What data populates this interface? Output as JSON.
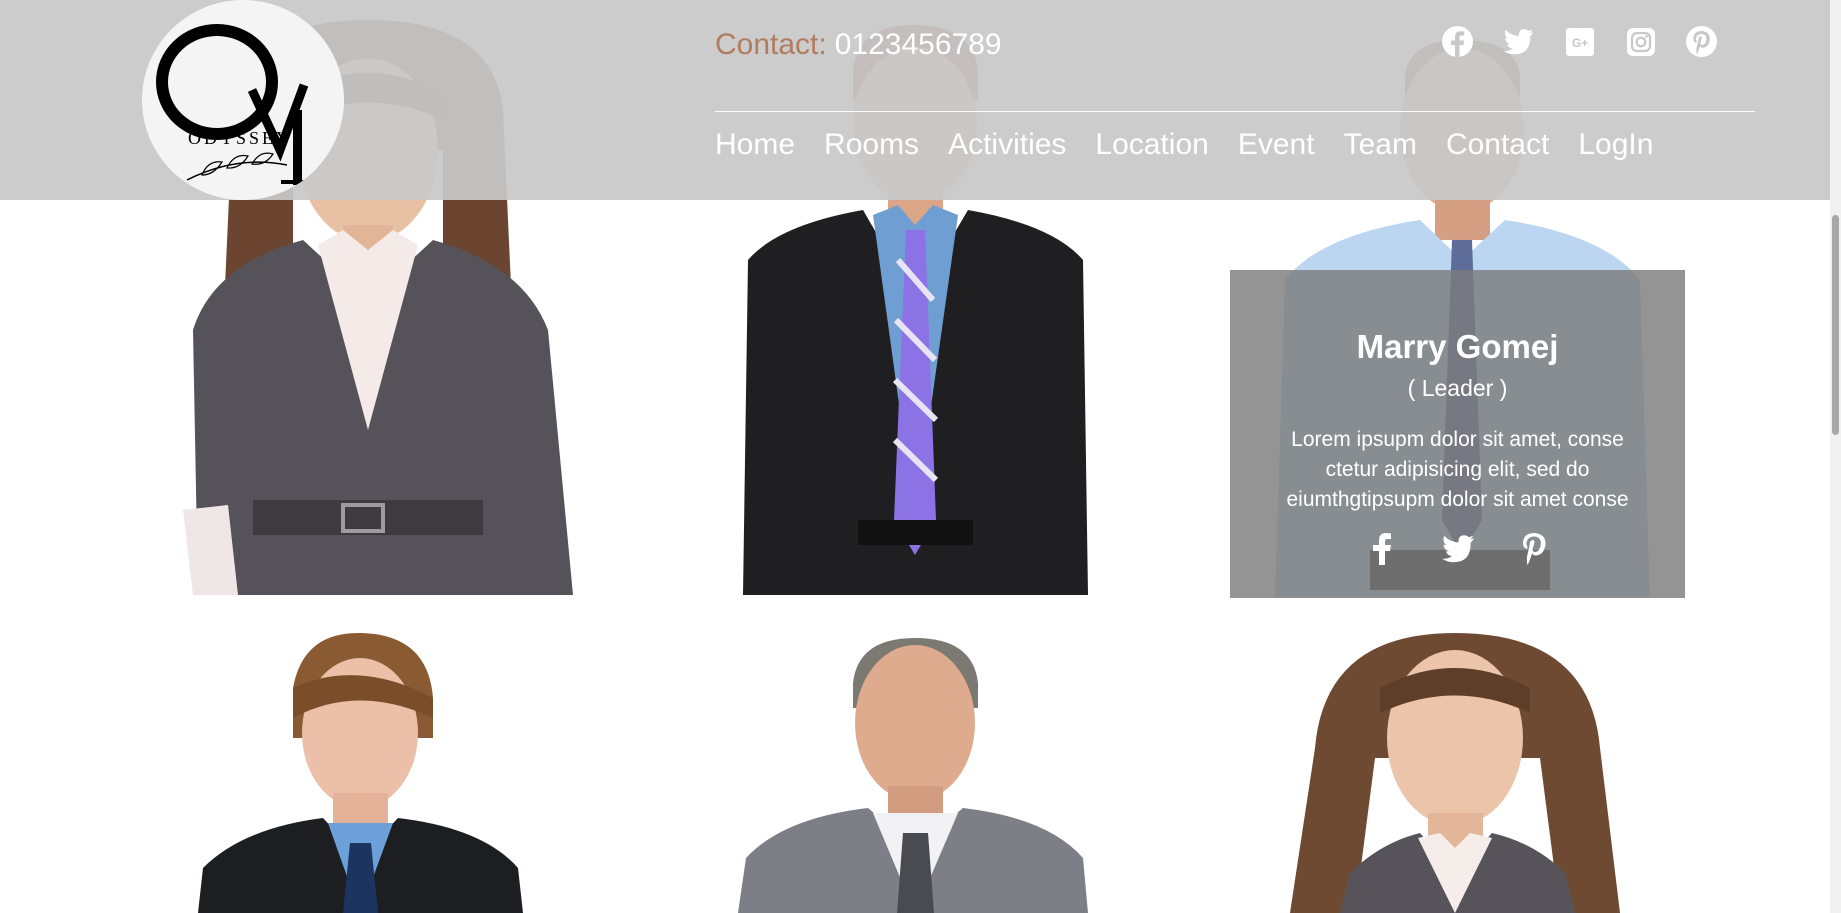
{
  "brand": {
    "logo_text": "ODYSSEY",
    "logo_monogram": "OY"
  },
  "header": {
    "contact_label": "Contact:",
    "contact_phone": "0123456789",
    "social_icons": [
      "facebook-icon",
      "twitter-icon",
      "google-plus-icon",
      "instagram-icon",
      "pinterest-icon"
    ]
  },
  "nav": {
    "items": [
      {
        "label": "Home"
      },
      {
        "label": "Rooms"
      },
      {
        "label": "Activities"
      },
      {
        "label": "Location"
      },
      {
        "label": "Event"
      },
      {
        "label": "Team"
      },
      {
        "label": "Contact"
      },
      {
        "label": "LogIn"
      }
    ]
  },
  "team": {
    "members": [
      {
        "photo": "woman-grey-jacket"
      },
      {
        "photo": "man-black-suit-purple-tie"
      },
      {
        "photo": "man-light-blue-shirt"
      },
      {
        "photo": "young-man-dark-suit"
      },
      {
        "photo": "older-man-grey-suit"
      },
      {
        "photo": "woman-curly-hair"
      }
    ],
    "hover_card": {
      "name": "Marry Gomej",
      "role": "( Leader )",
      "bio": "Lorem ipsupm dolor sit amet, conse ctetur adipisicing elit, sed do eiumthgtipsupm dolor sit amet conse",
      "social_icons": [
        "facebook-icon",
        "twitter-icon",
        "pinterest-icon"
      ]
    }
  },
  "colors": {
    "header_bg": "#c8c8c8",
    "contact_label": "#b07d5e",
    "card_bg": "#7d7d7d",
    "text_light": "#ffffff"
  }
}
